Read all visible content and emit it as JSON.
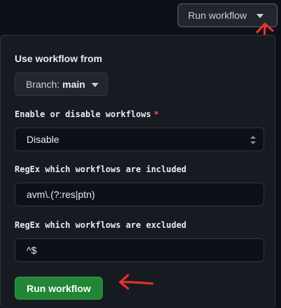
{
  "trigger": {
    "label": "Run workflow"
  },
  "panel": {
    "use_from_label": "Use workflow from",
    "branch": {
      "prefix": "Branch:",
      "value": "main"
    },
    "enable_disable": {
      "label": "Enable or disable workflows",
      "required_mark": "*",
      "selected": "Disable"
    },
    "regex_included": {
      "label": "RegEx which workflows are included",
      "value": "avm\\.(?:res|ptn)"
    },
    "regex_excluded": {
      "label": "RegEx which workflows are excluded",
      "value": "^$"
    },
    "run_button_label": "Run workflow"
  },
  "colors": {
    "background": "#0d1117",
    "panel": "#161b22",
    "primary_button": "#238636",
    "required": "#f85149",
    "annotation_arrow": "#e5312b"
  },
  "icons": [
    "caret-down-icon",
    "select-arrows-icon"
  ]
}
